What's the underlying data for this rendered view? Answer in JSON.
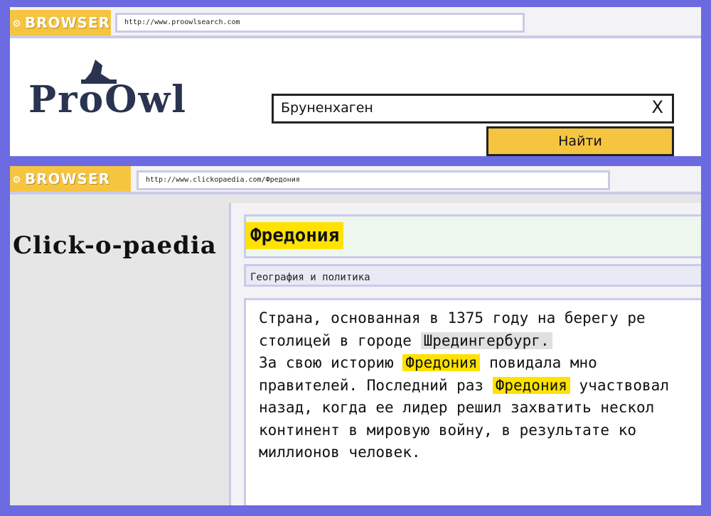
{
  "top_browser": {
    "brand": "BROWSER",
    "url": "http://www.proowlsearch.com",
    "logo": "ProOwl",
    "search_value": "Бруненхаген",
    "clear_label": "X",
    "find_label": "Найти"
  },
  "bottom_browser": {
    "brand": "BROWSER",
    "url": "http://www.clickopaedia.com/Фредония",
    "site_logo": "Click-o-paedia",
    "article_title": "Фредония",
    "category": "География и политика",
    "lines": [
      [
        "Страна, основанная в 1375 году на берегу ре"
      ],
      [
        "столицей в городе ",
        "Шредингербург."
      ],
      [
        "За свою историю ",
        "Фредония",
        " повидала мно"
      ],
      [
        "правителей. Последний раз ",
        "Фредония",
        " участвовал"
      ],
      [
        "назад, когда ее лидер решил захватить нескол"
      ],
      [
        "континент в мировую войну, в результате ко"
      ],
      [
        "миллионов человек."
      ]
    ]
  }
}
